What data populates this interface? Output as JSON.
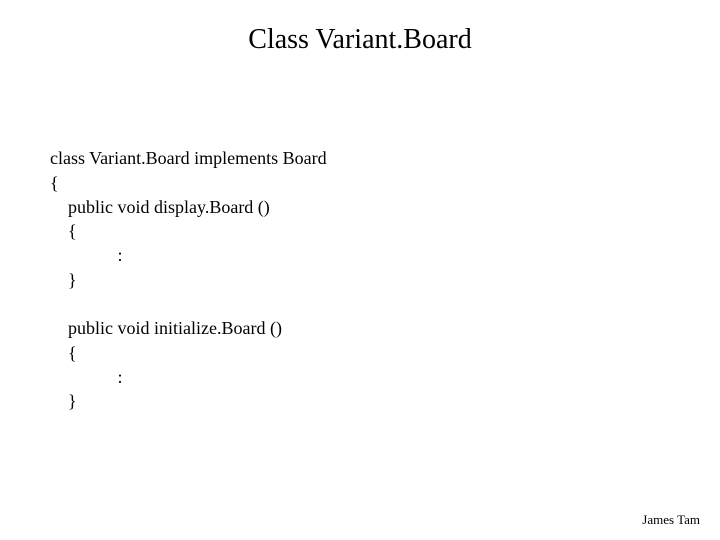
{
  "title": "Class Variant.Board",
  "code": {
    "line1": "class Variant.Board implements Board",
    "line2": "{",
    "line3": "    public void display.Board ()",
    "line4": "    {",
    "line5": "               :",
    "line6": "    }",
    "blank1": "",
    "line7": "    public void initialize.Board ()",
    "line8": "    {",
    "line9": "               :",
    "line10": "    }"
  },
  "footer": "James Tam"
}
